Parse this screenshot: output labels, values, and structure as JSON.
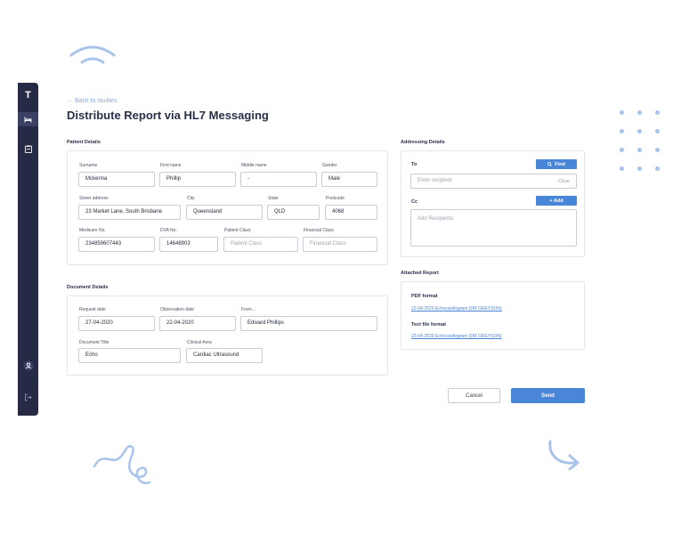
{
  "sidebar": {
    "logo": "T",
    "items": [
      {
        "icon": "bed-icon"
      },
      {
        "icon": "clipboard-icon"
      },
      {
        "icon": "user-icon"
      },
      {
        "icon": "logout-icon"
      }
    ]
  },
  "header": {
    "back_label": "← Back to studies",
    "title": "Distribute Report via HL7 Messaging"
  },
  "patient": {
    "section_title": "Patient Details",
    "surname_label": "Surname",
    "surname": "Mckenna",
    "first_name_label": "First name",
    "first_name": "Phillip",
    "middle_name_label": "Middle name",
    "middle_name": "-",
    "gender_label": "Gender",
    "gender": "Male",
    "street_label": "Street address",
    "street": "23 Market Lane, South Brisbane",
    "city_label": "City",
    "city": "Queensland",
    "state_label": "State",
    "state": "QLD",
    "postcode_label": "Postcode",
    "postcode": "4068",
    "medicare_label": "Medicare No.",
    "medicare": "234859607443",
    "dva_label": "DVA No.",
    "dva": "14648903",
    "patient_class_label": "Patient Class",
    "patient_class_placeholder": "Patient Class",
    "financial_class_label": "Financial Class",
    "financial_class_placeholder": "Financial Class"
  },
  "document": {
    "section_title": "Document Details",
    "request_date_label": "Request date",
    "request_date": "27-04-2020",
    "observation_date_label": "Observation date",
    "observation_date": "22-04-2020",
    "from_label": "From...",
    "from": "Edward Phillips",
    "title_label": "Document Title",
    "title": "Echo",
    "clinical_area_label": "Clinical Area",
    "clinical_area": "Cardiac Ultrasound"
  },
  "addressing": {
    "section_title": "Addressing Details",
    "to_label": "To",
    "find_label": "Find",
    "to_placeholder": "Enter recipient",
    "clear_label": "Clear",
    "cc_label": "Cc",
    "add_label": "+ Add",
    "cc_placeholder": "Add Recipients"
  },
  "attached": {
    "section_title": "Attached Report",
    "pdf_label": "PDF format",
    "pdf_link": "22-04-2020 Echocardiogram (DR GREYSON)",
    "text_label": "Text file format",
    "text_link": "22-04-2020 Echocardiogram (DR GREYSON)"
  },
  "actions": {
    "cancel": "Cancel",
    "send": "Send"
  },
  "colors": {
    "accent": "#4a86d8",
    "sidebar": "#262a45",
    "decoration": "#a9c4ea"
  }
}
